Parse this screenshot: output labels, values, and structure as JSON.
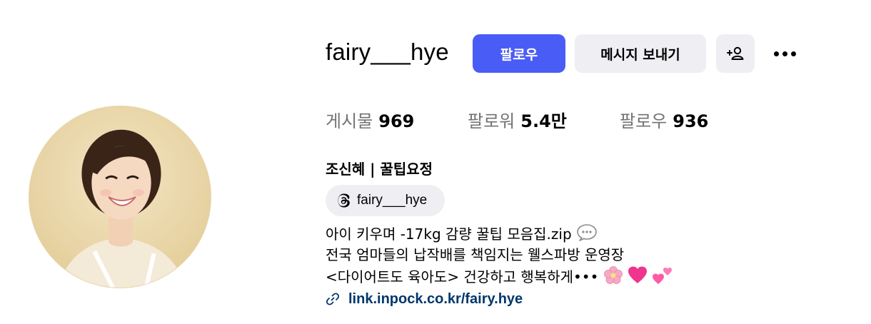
{
  "profile": {
    "username": "fairy___hye",
    "full_name": "조신혜 | 꿀팁요정",
    "avatar_alt": "profile photo"
  },
  "actions": {
    "follow_label": "팔로우",
    "message_label": "메시지 보내기",
    "suggest_icon": "person-plus-icon",
    "more_icon": "more-horizontal-icon"
  },
  "stats": {
    "posts_label": "게시물",
    "posts_value": "969",
    "followers_label": "팔로워",
    "followers_value": "5.4만",
    "following_label": "팔로우",
    "following_value": "936"
  },
  "threads": {
    "icon": "threads-icon",
    "handle": "fairy___hye"
  },
  "bio": {
    "line1": "아이 키우며 -17kg 감량 꿀팁 모음집.zip",
    "line1_emoji": "💬",
    "line2": "전국 엄마들의 납작배를 책임지는 웰스파방 운영장",
    "line3": "<다이어트도 육아도> 건강하고 행복하게•••",
    "line3_emoji": "🌸💗💕"
  },
  "link": {
    "icon": "link-icon",
    "text": "link.inpock.co.kr/fairy.hye"
  },
  "colors": {
    "primary_button": "#4a5cf6",
    "secondary_button": "#efeff3",
    "muted_text": "#737373",
    "link_text": "#00376b"
  }
}
